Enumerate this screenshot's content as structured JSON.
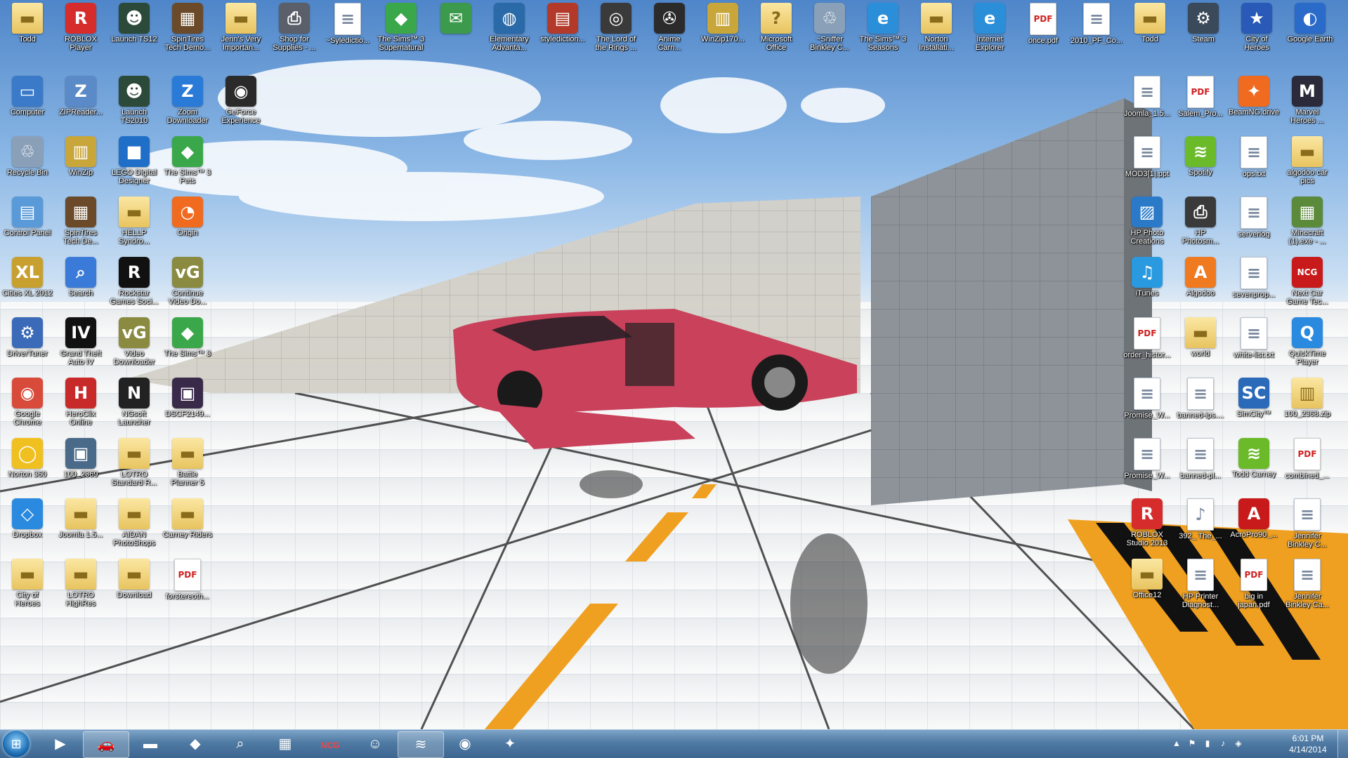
{
  "desktop": {
    "icons": [
      {
        "label": "Todd",
        "icon": "folder-icon",
        "glyph": "▬",
        "kind": "folder",
        "color": "#e8c460"
      },
      {
        "label": "ROBLOX\nPlayer",
        "icon": "roblox-icon",
        "glyph": "R",
        "kind": "app",
        "color": "#d62c2c"
      },
      {
        "label": "Launch TS12",
        "icon": "game-icon",
        "glyph": "☻",
        "kind": "app",
        "color": "#2b4a3a"
      },
      {
        "label": "SpinTires\nTech Demo...",
        "icon": "spintires-icon",
        "glyph": "▦",
        "kind": "app",
        "color": "#6b4a2a"
      },
      {
        "label": "Jenn's Very\nImportan...",
        "icon": "folder-icon",
        "glyph": "▬",
        "kind": "folder",
        "color": "#e8c460"
      },
      {
        "label": "Shop for\nSupplies - ...",
        "icon": "printer-icon",
        "glyph": "⎙",
        "kind": "app",
        "color": "#5a5f6a"
      },
      {
        "label": "~Syledictio...",
        "icon": "document-icon",
        "glyph": "≡",
        "kind": "doc",
        "color": "#ffffff"
      },
      {
        "label": "The Sims™ 3\nSupernatural",
        "icon": "sims-icon",
        "glyph": "◆",
        "kind": "app",
        "color": "#3aa84a"
      },
      {
        "label": "",
        "icon": "email-icon",
        "glyph": "✉",
        "kind": "app",
        "color": "#3b9a4b"
      },
      {
        "label": "Elementary\nAdvanta...",
        "icon": "globe-icon",
        "glyph": "◍",
        "kind": "app",
        "color": "#2a6aa8"
      },
      {
        "label": "stylediction...",
        "icon": "books-icon",
        "glyph": "▤",
        "kind": "app",
        "color": "#b33a2a"
      },
      {
        "label": "The Lord of\nthe Rings ...",
        "icon": "lotr-icon",
        "glyph": "◎",
        "kind": "app",
        "color": "#3a3a3a"
      },
      {
        "label": "Anime\nCarn...",
        "icon": "film-reel-icon",
        "glyph": "✇",
        "kind": "app",
        "color": "#2b2b2b"
      },
      {
        "label": "WinZip170...",
        "icon": "winzip-icon",
        "glyph": "▥",
        "kind": "app",
        "color": "#c9a63a"
      },
      {
        "label": "Microsoft\nOffice",
        "icon": "folder-help-icon",
        "glyph": "?",
        "kind": "folder",
        "color": "#e8c460"
      },
      {
        "label": "~Sniffer\nBinkley C...",
        "icon": "recycle-bin-icon",
        "glyph": "♲",
        "kind": "app",
        "color": "#8aa0b8"
      },
      {
        "label": "The Sims™ 3\nSeasons",
        "icon": "ie-icon",
        "glyph": "e",
        "kind": "app",
        "color": "#2a8fd8"
      },
      {
        "label": "Norton\nInstallati...",
        "icon": "folder-icon",
        "glyph": "▬",
        "kind": "folder",
        "color": "#e8c460"
      },
      {
        "label": "Internet\nExplorer",
        "icon": "ie-icon",
        "glyph": "e",
        "kind": "app",
        "color": "#2a8fd8"
      },
      {
        "label": "once.pdf",
        "icon": "pdf-icon",
        "glyph": "PDF",
        "kind": "pdf",
        "color": "#ffffff"
      },
      {
        "label": "2010_PF_Co...",
        "icon": "document-icon",
        "glyph": "≡",
        "kind": "doc",
        "color": "#ffffff"
      },
      {
        "label": "Todd",
        "icon": "folder-icon",
        "glyph": "▬",
        "kind": "folder",
        "color": "#e8c460"
      },
      {
        "label": "Steam",
        "icon": "steam-icon",
        "glyph": "⚙",
        "kind": "app",
        "color": "#3a4a5a"
      },
      {
        "label": "City of\nHeroes",
        "icon": "heroes-icon",
        "glyph": "★",
        "kind": "app",
        "color": "#2a5ab8"
      },
      {
        "label": "Google Earth",
        "icon": "google-earth-icon",
        "glyph": "◐",
        "kind": "app",
        "color": "#2a6ac8"
      },
      {
        "label": "Computer",
        "icon": "computer-icon",
        "glyph": "▭",
        "kind": "app",
        "color": "#3a7ac8"
      },
      {
        "label": "ZIPReader...",
        "icon": "zip-icon",
        "glyph": "Z",
        "kind": "app",
        "color": "#5a8ac8"
      },
      {
        "label": "Launch\nTS2010",
        "icon": "game-icon",
        "glyph": "☻",
        "kind": "app",
        "color": "#2b4a3a"
      },
      {
        "label": "Zoom\nDownloader",
        "icon": "zoom-icon",
        "glyph": "Z",
        "kind": "app",
        "color": "#2a7ad8"
      },
      {
        "label": "GeForce\nExperience",
        "icon": "nvidia-icon",
        "glyph": "◉",
        "kind": "app",
        "color": "#2a2a2a"
      },
      {
        "label": "Recycle Bin",
        "icon": "recycle-bin-icon",
        "glyph": "♲",
        "kind": "app",
        "color": "#8aa0b8"
      },
      {
        "label": "WinZip",
        "icon": "winzip-icon",
        "glyph": "▥",
        "kind": "app",
        "color": "#c9a63a"
      },
      {
        "label": "LEGO Digital\nDesigner",
        "icon": "lego-icon",
        "glyph": "■",
        "kind": "app",
        "color": "#1f6fc8"
      },
      {
        "label": "The Sims™ 3\nPets",
        "icon": "sims-icon",
        "glyph": "◆",
        "kind": "app",
        "color": "#3aa84a"
      },
      {
        "label": "Control Panel",
        "icon": "control-panel-icon",
        "glyph": "▤",
        "kind": "app",
        "color": "#5a9ad8"
      },
      {
        "label": "SpinTires\nTech De...",
        "icon": "spintires-icon",
        "glyph": "▦",
        "kind": "app",
        "color": "#6b4a2a"
      },
      {
        "label": "HELLP\nSyndro...",
        "icon": "folder-icon",
        "glyph": "▬",
        "kind": "folder",
        "color": "#e8c460"
      },
      {
        "label": "Origin",
        "icon": "origin-icon",
        "glyph": "◔",
        "kind": "app",
        "color": "#f06a20"
      },
      {
        "label": "Cities XL 2012",
        "icon": "cities-xl-icon",
        "glyph": "XL",
        "kind": "app",
        "color": "#c8a030"
      },
      {
        "label": "Search",
        "icon": "search-icon",
        "glyph": "⌕",
        "kind": "app",
        "color": "#3a7ad8"
      },
      {
        "label": "Rockstar\nGames Soci...",
        "icon": "rockstar-icon",
        "glyph": "R",
        "kind": "app",
        "color": "#111111"
      },
      {
        "label": "Continue\nVideo Do...",
        "icon": "video-downloader-icon",
        "glyph": "vG",
        "kind": "app",
        "color": "#8a8a40"
      },
      {
        "label": "DriverTuner",
        "icon": "drivertuner-icon",
        "glyph": "⚙",
        "kind": "app",
        "color": "#3a6ab8"
      },
      {
        "label": "Grand Theft\nAuto IV",
        "icon": "gta-icon",
        "glyph": "IV",
        "kind": "app",
        "color": "#111111"
      },
      {
        "label": "Video\nDownloader",
        "icon": "video-downloader-icon",
        "glyph": "vG",
        "kind": "app",
        "color": "#8a8a40"
      },
      {
        "label": "The Sims™ 3",
        "icon": "sims-icon",
        "glyph": "◆",
        "kind": "app",
        "color": "#3aa84a"
      },
      {
        "label": "Google\nChrome",
        "icon": "chrome-icon",
        "glyph": "◉",
        "kind": "app",
        "color": "#d84a3a"
      },
      {
        "label": "HeroClix\nOnline",
        "icon": "heroclix-icon",
        "glyph": "H",
        "kind": "app",
        "color": "#c82a2a"
      },
      {
        "label": "NGsoft\nLauncher",
        "icon": "ngsoft-icon",
        "glyph": "N",
        "kind": "app",
        "color": "#222222"
      },
      {
        "label": "DSCF2149...",
        "icon": "photo-icon",
        "glyph": "▣",
        "kind": "app",
        "color": "#3a2a4a"
      },
      {
        "label": "Norton 360",
        "icon": "norton-icon",
        "glyph": "◯",
        "kind": "app",
        "color": "#f0c020"
      },
      {
        "label": "100_2369",
        "icon": "photo-icon",
        "glyph": "▣",
        "kind": "app",
        "color": "#4a6a8a"
      },
      {
        "label": "LOTRO\nStandard R...",
        "icon": "folder-icon",
        "glyph": "▬",
        "kind": "folder",
        "color": "#e8c460"
      },
      {
        "label": "Battle\nPlanner 5",
        "icon": "folder-icon",
        "glyph": "▬",
        "kind": "folder",
        "color": "#e8c460"
      },
      {
        "label": "Dropbox",
        "icon": "dropbox-icon",
        "glyph": "◇",
        "kind": "app",
        "color": "#2a8ae0"
      },
      {
        "label": "Joomla 1.5...",
        "icon": "folder-icon",
        "glyph": "▬",
        "kind": "folder",
        "color": "#e8c460"
      },
      {
        "label": "AIDAN\nPhotoShops",
        "icon": "folder-icon",
        "glyph": "▬",
        "kind": "folder",
        "color": "#e8c460"
      },
      {
        "label": "Carney Riders",
        "icon": "folder-icon",
        "glyph": "▬",
        "kind": "folder",
        "color": "#e8c460"
      },
      {
        "label": "City of\nHeroes",
        "icon": "folder-icon",
        "glyph": "▬",
        "kind": "folder",
        "color": "#e8c460"
      },
      {
        "label": "LOTRO\nHighRes",
        "icon": "folder-icon",
        "glyph": "▬",
        "kind": "folder",
        "color": "#e8c460"
      },
      {
        "label": "Download",
        "icon": "folder-icon",
        "glyph": "▬",
        "kind": "folder",
        "color": "#e8c460"
      },
      {
        "label": "forstereoth...",
        "icon": "pdf-icon",
        "glyph": "PDF",
        "kind": "pdf",
        "color": "#ffffff"
      },
      {
        "label": "Joomla_1.5...",
        "icon": "document-icon",
        "glyph": "≡",
        "kind": "doc",
        "color": "#ffffff"
      },
      {
        "label": "Salem_Pro...",
        "icon": "pdf-icon",
        "glyph": "PDF",
        "kind": "pdf",
        "color": "#ffffff"
      },
      {
        "label": "BeamNG.drive",
        "icon": "beamng-icon",
        "glyph": "✦",
        "kind": "app",
        "color": "#f06a20"
      },
      {
        "label": "Marvel\nHeroes ...",
        "icon": "marvel-icon",
        "glyph": "M",
        "kind": "app",
        "color": "#2a2a3a"
      },
      {
        "label": "MOD3[1].ppt",
        "icon": "document-icon",
        "glyph": "≡",
        "kind": "doc",
        "color": "#ffffff"
      },
      {
        "label": "Spotify",
        "icon": "spotify-icon",
        "glyph": "≋",
        "kind": "app",
        "color": "#6aba2a"
      },
      {
        "label": "ops.txt",
        "icon": "document-icon",
        "glyph": "≡",
        "kind": "doc",
        "color": "#ffffff"
      },
      {
        "label": "algodoo car\npics",
        "icon": "folder-icon",
        "glyph": "▬",
        "kind": "folder",
        "color": "#e8c460"
      },
      {
        "label": "HP Photo\nCreations",
        "icon": "hp-photo-icon",
        "glyph": "▨",
        "kind": "app",
        "color": "#2a7ac8"
      },
      {
        "label": "HP\nPhotosm...",
        "icon": "printer-icon",
        "glyph": "⎙",
        "kind": "app",
        "color": "#3a3a3a"
      },
      {
        "label": "serverlog",
        "icon": "document-icon",
        "glyph": "≡",
        "kind": "doc",
        "color": "#ffffff"
      },
      {
        "label": "Minecraft\n(1).exe - ...",
        "icon": "minecraft-icon",
        "glyph": "▦",
        "kind": "app",
        "color": "#5a8a3a"
      },
      {
        "label": "iTunes",
        "icon": "itunes-icon",
        "glyph": "♫",
        "kind": "app",
        "color": "#2a9ae0"
      },
      {
        "label": "Algodoo",
        "icon": "algodoo-icon",
        "glyph": "A",
        "kind": "app",
        "color": "#f07a20"
      },
      {
        "label": "sevenprop...",
        "icon": "document-icon",
        "glyph": "≡",
        "kind": "doc",
        "color": "#ffffff"
      },
      {
        "label": "Next Car\nGame Tec...",
        "icon": "ncg-icon",
        "glyph": "NCG",
        "kind": "app",
        "color": "#c81a1a"
      },
      {
        "label": "order_histor...",
        "icon": "pdf-icon",
        "glyph": "PDF",
        "kind": "pdf",
        "color": "#ffffff"
      },
      {
        "label": "world",
        "icon": "folder-icon",
        "glyph": "▬",
        "kind": "folder",
        "color": "#e8c460"
      },
      {
        "label": "white-list.txt",
        "icon": "document-icon",
        "glyph": "≡",
        "kind": "doc",
        "color": "#ffffff"
      },
      {
        "label": "QuickTime\nPlayer",
        "icon": "quicktime-icon",
        "glyph": "Q",
        "kind": "app",
        "color": "#2a8ae0"
      },
      {
        "label": "Promise_W...",
        "icon": "document-icon",
        "glyph": "≡",
        "kind": "doc",
        "color": "#ffffff"
      },
      {
        "label": "banned-ips....",
        "icon": "document-icon",
        "glyph": "≡",
        "kind": "doc",
        "color": "#ffffff"
      },
      {
        "label": "SimCity™",
        "icon": "simcity-icon",
        "glyph": "SC",
        "kind": "app",
        "color": "#2a6ab8"
      },
      {
        "label": "100_2368.zip",
        "icon": "zip-icon",
        "glyph": "▥",
        "kind": "folder",
        "color": "#e8c460"
      },
      {
        "label": "Promise_W...",
        "icon": "document-icon",
        "glyph": "≡",
        "kind": "doc",
        "color": "#ffffff"
      },
      {
        "label": "banned-pl...",
        "icon": "document-icon",
        "glyph": "≡",
        "kind": "doc",
        "color": "#ffffff"
      },
      {
        "label": "Todd Carney",
        "icon": "spotify-icon",
        "glyph": "≋",
        "kind": "app",
        "color": "#6aba2a"
      },
      {
        "label": "combined_...",
        "icon": "pdf-icon",
        "glyph": "PDF",
        "kind": "pdf",
        "color": "#ffffff"
      },
      {
        "label": "ROBLOX\nStudio 2013",
        "icon": "roblox-studio-icon",
        "glyph": "R",
        "kind": "app",
        "color": "#d62c2c"
      },
      {
        "label": "392_ The_...",
        "icon": "mp3-icon",
        "glyph": "♪",
        "kind": "doc",
        "color": "#ffffff"
      },
      {
        "label": "AcroPro90_...",
        "icon": "acrobat-icon",
        "glyph": "A",
        "kind": "app",
        "color": "#c81a1a"
      },
      {
        "label": "Jennifer\nBinkley C...",
        "icon": "document-icon",
        "glyph": "≡",
        "kind": "doc",
        "color": "#ffffff"
      },
      {
        "label": "Office12",
        "icon": "folder-icon",
        "glyph": "▬",
        "kind": "folder",
        "color": "#e8c460"
      },
      {
        "label": "HP Printer\nDiagnost...",
        "icon": "document-icon",
        "glyph": "≡",
        "kind": "doc",
        "color": "#ffffff"
      },
      {
        "label": "big in\njapan.pdf",
        "icon": "pdf-icon",
        "glyph": "PDF",
        "kind": "pdf",
        "color": "#ffffff"
      },
      {
        "label": "Jennifer\nBinkley Ca...",
        "icon": "document-icon",
        "glyph": "≡",
        "kind": "doc",
        "color": "#ffffff"
      }
    ]
  },
  "taskbar": {
    "start_glyph": "⊞",
    "pinned": [
      {
        "name": "media-player-button",
        "icon": "media-player-icon",
        "glyph": "▶",
        "active": false
      },
      {
        "name": "beamng-task-button",
        "icon": "beamng-icon",
        "glyph": "🚗",
        "active": true
      },
      {
        "name": "explorer-button",
        "icon": "folder-icon",
        "glyph": "▬",
        "active": false
      },
      {
        "name": "unknown-app-button",
        "icon": "app-icon",
        "glyph": "◆",
        "active": false
      },
      {
        "name": "search-button",
        "icon": "search-icon",
        "glyph": "⌕",
        "active": false
      },
      {
        "name": "calculator-button",
        "icon": "calculator-icon",
        "glyph": "▦",
        "active": false
      },
      {
        "name": "ncg-button",
        "icon": "ncg-icon",
        "glyph": "NCG",
        "active": false
      },
      {
        "name": "people-button",
        "icon": "people-icon",
        "glyph": "☺",
        "active": false
      },
      {
        "name": "spotify-task-button",
        "icon": "spotify-icon",
        "glyph": "≋",
        "active": true
      },
      {
        "name": "chrome-task-button",
        "icon": "chrome-icon",
        "glyph": "◉",
        "active": false
      },
      {
        "name": "share-button",
        "icon": "share-icon",
        "glyph": "✦",
        "active": false
      }
    ],
    "tray": {
      "icons": [
        "show-hidden-icon",
        "flag-icon",
        "network-icon",
        "volume-icon",
        "tray-app-icon"
      ],
      "glyphs": [
        "▲",
        "⚑",
        "▮",
        "♪",
        "◈"
      ],
      "time": "6:01 PM",
      "date": "4/14/2014"
    }
  },
  "colors": {
    "sky_top": "#4f86c9",
    "taskbar": "#3d6690",
    "car": "#c9415a"
  }
}
